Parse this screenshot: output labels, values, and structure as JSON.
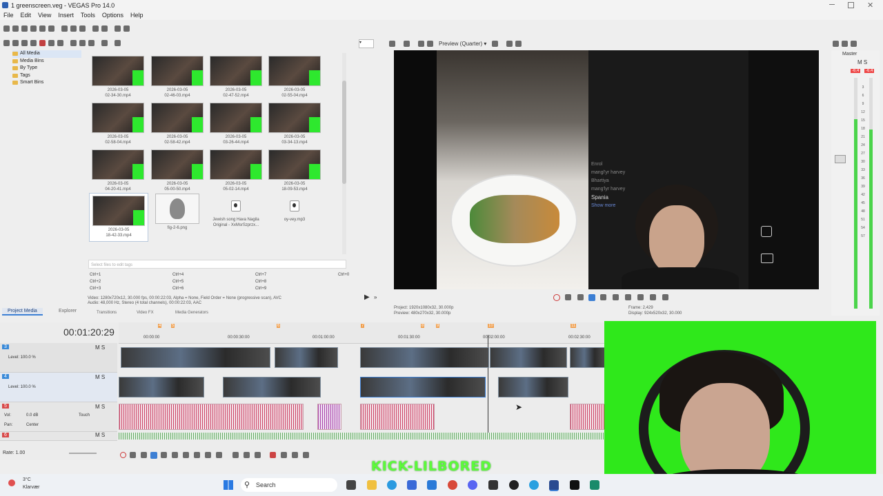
{
  "window": {
    "title": "1 greenscreen.veg - VEGAS Pro 14.0"
  },
  "menu": [
    "File",
    "Edit",
    "View",
    "Insert",
    "Tools",
    "Options",
    "Help"
  ],
  "tree": [
    "All Media",
    "Media Bins",
    "By Type",
    "Tags",
    "Smart Bins"
  ],
  "media": [
    {
      "date": "2026-03-05",
      "name": "02-34-30.mp4"
    },
    {
      "date": "2026-03-05",
      "name": "02-46-03.mp4"
    },
    {
      "date": "2026-03-05",
      "name": "02-47-52.mp4"
    },
    {
      "date": "2026-03-05",
      "name": "02-55-04.mp4"
    },
    {
      "date": "2026-03-05",
      "name": "02-58-04.mp4"
    },
    {
      "date": "2026-03-05",
      "name": "02-58-42.mp4"
    },
    {
      "date": "2026-03-05",
      "name": "03-26-44.mp4"
    },
    {
      "date": "2026-03-05",
      "name": "03-34-13.mp4"
    },
    {
      "date": "2026-03-05",
      "name": "04-20-41.mp4"
    },
    {
      "date": "2026-03-05",
      "name": "05-00-50.mp4"
    },
    {
      "date": "2026-03-05",
      "name": "05-02-14.mp4"
    },
    {
      "date": "2026-03-05",
      "name": "18-09-53.mp4"
    },
    {
      "date": "2026-03-05",
      "name": "18-42-33.mp4"
    },
    {
      "date": "",
      "name": "fig-2-6.png"
    },
    {
      "date": "",
      "name": "Jewish song Hava Nagila Original - XxMsrSzprzx..."
    },
    {
      "date": "",
      "name": "oy-vey.mp3"
    }
  ],
  "tags_placeholder": "Select files to edit tags",
  "shortcuts": [
    "Ctrl+1",
    "Ctrl+2",
    "Ctrl+3",
    "Ctrl+4",
    "Ctrl+5",
    "Ctrl+6",
    "Ctrl+7",
    "Ctrl+8",
    "Ctrl+9",
    "Ctrl+0"
  ],
  "media_info": {
    "video": "Video: 1280x720x12, 30.000 fps, 00:00:22:03, Alpha = None, Field Order = None (progressive scan), AVC",
    "audio": "Audio: 48,000 Hz, Stereo (4 total channels), 00:00:22:03, AAC"
  },
  "panel_tabs": [
    "Project Media",
    "Explorer",
    "Transitions",
    "Video FX",
    "Media Generators"
  ],
  "preview": {
    "mode": "Preview (Quarter)",
    "project": "Project:  1920x1080x32, 30.000p",
    "preview": "Preview:  480x270x32, 30.000p",
    "frame": "Frame:   2,429",
    "display": "Display:  924x520x32, 30.000",
    "overlay": [
      "Enrol",
      "mangl'yr harvey",
      "Bhartiya",
      "mang'lyr harvey",
      "Spania",
      "Show more"
    ]
  },
  "master": {
    "label": "Master",
    "peak_left": "-6.4",
    "peak_right": "-6.4",
    "scale": [
      "3",
      "6",
      "9",
      "12",
      "15",
      "18",
      "21",
      "24",
      "27",
      "30",
      "33",
      "36",
      "39",
      "42",
      "45",
      "48",
      "51",
      "54",
      "57"
    ]
  },
  "timeline": {
    "timecode": "00:01:20:29",
    "ruler": [
      "00:00:00",
      "00:00:30:00",
      "00:01:00:00",
      "00:01:30:00",
      "00:02:00:00",
      "00:02:30:00"
    ],
    "markers": [
      "4",
      "5",
      "6",
      "7",
      "8",
      "9",
      "10",
      "11"
    ],
    "tracks": [
      {
        "num": "3",
        "level": "Level: 100.0 %"
      },
      {
        "num": "4",
        "level": "Level: 100.0 %"
      },
      {
        "num": "5",
        "vol": "Vol:",
        "vol_val": "0.0 dB",
        "touch": "Touch",
        "pan": "Pan:",
        "pan_val": "Center"
      },
      {
        "num": "6"
      }
    ],
    "rate": "Rate: 1.00"
  },
  "stream": {
    "overlay_text": "KICK-LILBORED"
  },
  "taskbar": {
    "weather_temp": "3°C",
    "weather_desc": "Klarvær",
    "search": "Search"
  },
  "colors": {
    "greenscreen": "#2fe81b",
    "meter": "#4bd44b",
    "selection": "#3c7fd4"
  }
}
